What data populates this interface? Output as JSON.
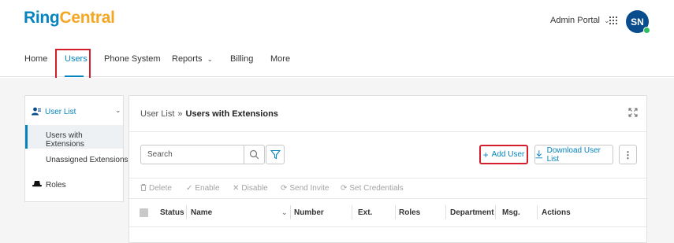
{
  "brand": {
    "logo_part1": "Ring",
    "logo_part2": "Central"
  },
  "header": {
    "portal_label": "Admin Portal",
    "avatar_initials": "SN"
  },
  "nav": {
    "home": "Home",
    "users": "Users",
    "phone_system": "Phone System",
    "reports": "Reports",
    "billing": "Billing",
    "more": "More"
  },
  "sidebar": {
    "user_list": "User List",
    "users_with_extensions": "Users with Extensions",
    "unassigned_extensions": "Unassigned Extensions",
    "roles": "Roles"
  },
  "breadcrumb": {
    "parent": "User List",
    "separator": "»",
    "current": "Users with Extensions"
  },
  "toolbar": {
    "search_placeholder": "Search",
    "add_user": "Add User",
    "download_user_list": "Download User List"
  },
  "actions": {
    "delete": "Delete",
    "enable": "Enable",
    "disable": "Disable",
    "send_invite": "Send Invite",
    "set_credentials": "Set Credentials"
  },
  "table": {
    "columns": {
      "status": "Status",
      "name": "Name",
      "number": "Number",
      "ext": "Ext.",
      "roles": "Roles",
      "department": "Department",
      "msg": "Msg.",
      "actions": "Actions"
    }
  },
  "colors": {
    "brand_blue": "#0684bd",
    "brand_orange": "#f5a623",
    "highlight_red": "#d41e2b",
    "avatar_bg": "#0a4d8c",
    "presence_green": "#2dbe60"
  },
  "icons": {
    "apps": "grid-icon",
    "expand": "expand-icon",
    "search": "search-icon",
    "filter": "filter-icon",
    "user_list": "user-list-icon",
    "roles": "roles-icon",
    "delete": "trash-icon",
    "enable": "check-icon",
    "disable": "x-icon",
    "send_invite": "refresh-icon",
    "set_credentials": "refresh-icon",
    "download": "download-icon",
    "more": "kebab-icon"
  }
}
